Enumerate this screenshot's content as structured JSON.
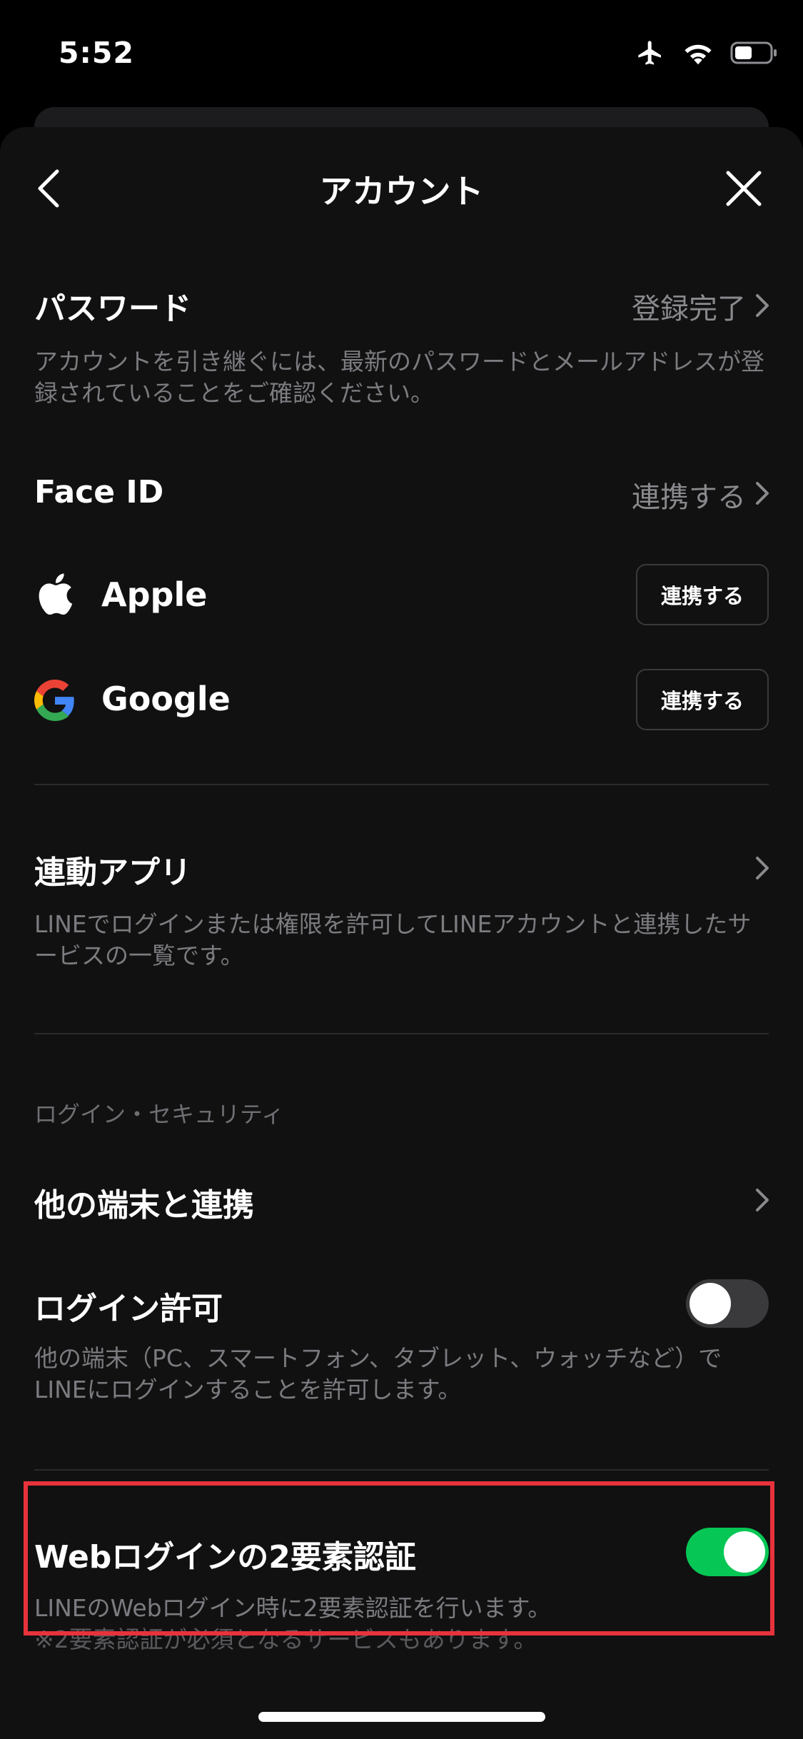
{
  "status_bar": {
    "time": "5:52",
    "battery_level": 0.45
  },
  "header": {
    "title": "アカウント",
    "back_icon": "chevron-left-icon",
    "close_icon": "close-icon"
  },
  "password": {
    "label": "パスワード",
    "value": "登録完了",
    "description": "アカウントを引き継ぐには、最新のパスワードとメールアドレスが登録されていることをご確認ください。"
  },
  "face_id": {
    "label": "Face ID",
    "value": "連携する"
  },
  "apple": {
    "label": "Apple",
    "button": "連携する",
    "icon": "apple-logo-icon"
  },
  "google": {
    "label": "Google",
    "button": "連携する",
    "icon": "google-logo-icon"
  },
  "linked_apps": {
    "label": "連動アプリ",
    "description": "LINEでログインまたは権限を許可してLINEアカウントと連携したサービスの一覧です。"
  },
  "section": {
    "login_security": "ログイン・セキュリティ"
  },
  "other_devices": {
    "label": "他の端末と連携"
  },
  "login_permission": {
    "label": "ログイン許可",
    "enabled": false,
    "description": "他の端末（PC、スマートフォン、タブレット、ウォッチなど）でLINEにログインすることを許可します。"
  },
  "web_2fa": {
    "label": "Webログインの2要素認証",
    "enabled": true,
    "description": "LINEのWebログイン時に2要素認証を行います。",
    "note": "※2要素認証が必須となるサービスもあります。"
  },
  "colors": {
    "background": "#111111",
    "accent_green": "#06c755",
    "highlight_red": "#e8323c",
    "secondary_text": "#7b7b80"
  }
}
